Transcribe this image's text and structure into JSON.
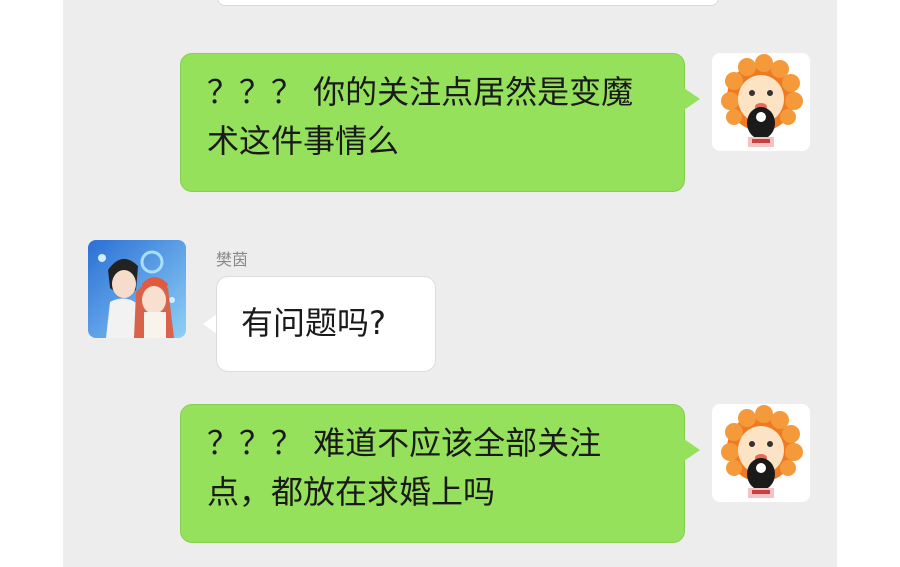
{
  "conversation": {
    "messages": [
      {
        "side": "right",
        "text": "？？？ 你的关注点居然是变魔术这件事情么",
        "avatar": "lion-sticker-avatar"
      },
      {
        "side": "left",
        "sender": "樊茵",
        "text": "有问题吗?",
        "avatar": "anime-couple-avatar"
      },
      {
        "side": "right",
        "text": "？？？ 难道不应该全部关注点，都放在求婚上吗",
        "avatar": "lion-sticker-avatar"
      }
    ]
  },
  "colors": {
    "chat_background": "#ededed",
    "outgoing_bubble": "#95e15c",
    "incoming_bubble": "#ffffff",
    "sender_name": "#8a8a8a"
  }
}
